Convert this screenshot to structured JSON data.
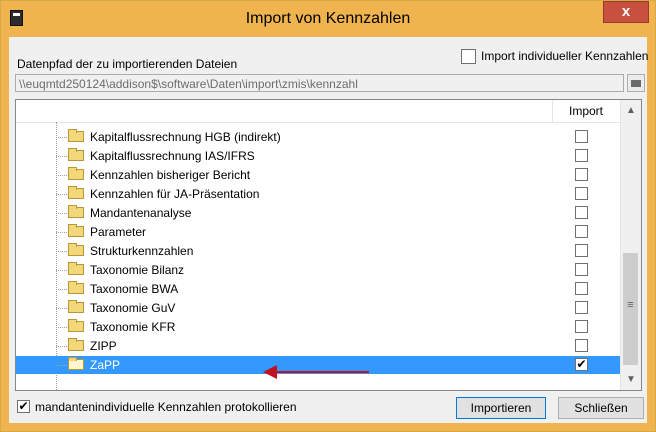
{
  "window": {
    "title": "Import von Kennzahlen",
    "close_label": "x"
  },
  "options": {
    "path_label": "Datenpfad der zu importierenden Dateien",
    "individual_import_label": "Import individueller Kennzahlen",
    "individual_import_checked": false,
    "path_value": "\\\\euqmtd250124\\addison$\\software\\Daten\\import\\zmis\\kennzahl"
  },
  "tree": {
    "column_import": "Import",
    "items": [
      {
        "label": "Kapitalflussrechnung HGB (indirekt)",
        "checked": false,
        "check_mark": ""
      },
      {
        "label": "Kapitalflussrechnung IAS/IFRS",
        "checked": false,
        "check_mark": ""
      },
      {
        "label": "Kennzahlen bisheriger Bericht",
        "checked": false,
        "check_mark": ""
      },
      {
        "label": "Kennzahlen für JA-Präsentation",
        "checked": false,
        "check_mark": ""
      },
      {
        "label": "Mandantenanalyse",
        "checked": false,
        "check_mark": ""
      },
      {
        "label": "Parameter",
        "checked": false,
        "check_mark": ""
      },
      {
        "label": "Strukturkennzahlen",
        "checked": false,
        "check_mark": ""
      },
      {
        "label": "Taxonomie Bilanz",
        "checked": false,
        "check_mark": ""
      },
      {
        "label": "Taxonomie BWA",
        "checked": false,
        "check_mark": ""
      },
      {
        "label": "Taxonomie GuV",
        "checked": false,
        "check_mark": ""
      },
      {
        "label": "Taxonomie KFR",
        "checked": false,
        "check_mark": ""
      },
      {
        "label": "ZIPP",
        "checked": false,
        "check_mark": ""
      },
      {
        "label": "ZaPP",
        "checked": true,
        "check_mark": "✔",
        "selected": true
      }
    ]
  },
  "footer": {
    "log_label": "mandantenindividuelle Kennzahlen protokollieren",
    "log_checked": true,
    "log_check_mark": "✔",
    "import_button": "Importieren",
    "close_button": "Schließen"
  },
  "colors": {
    "titlebar": "#f0b44e",
    "selection": "#3399ff",
    "annotation_arrow": "#c0131d"
  }
}
